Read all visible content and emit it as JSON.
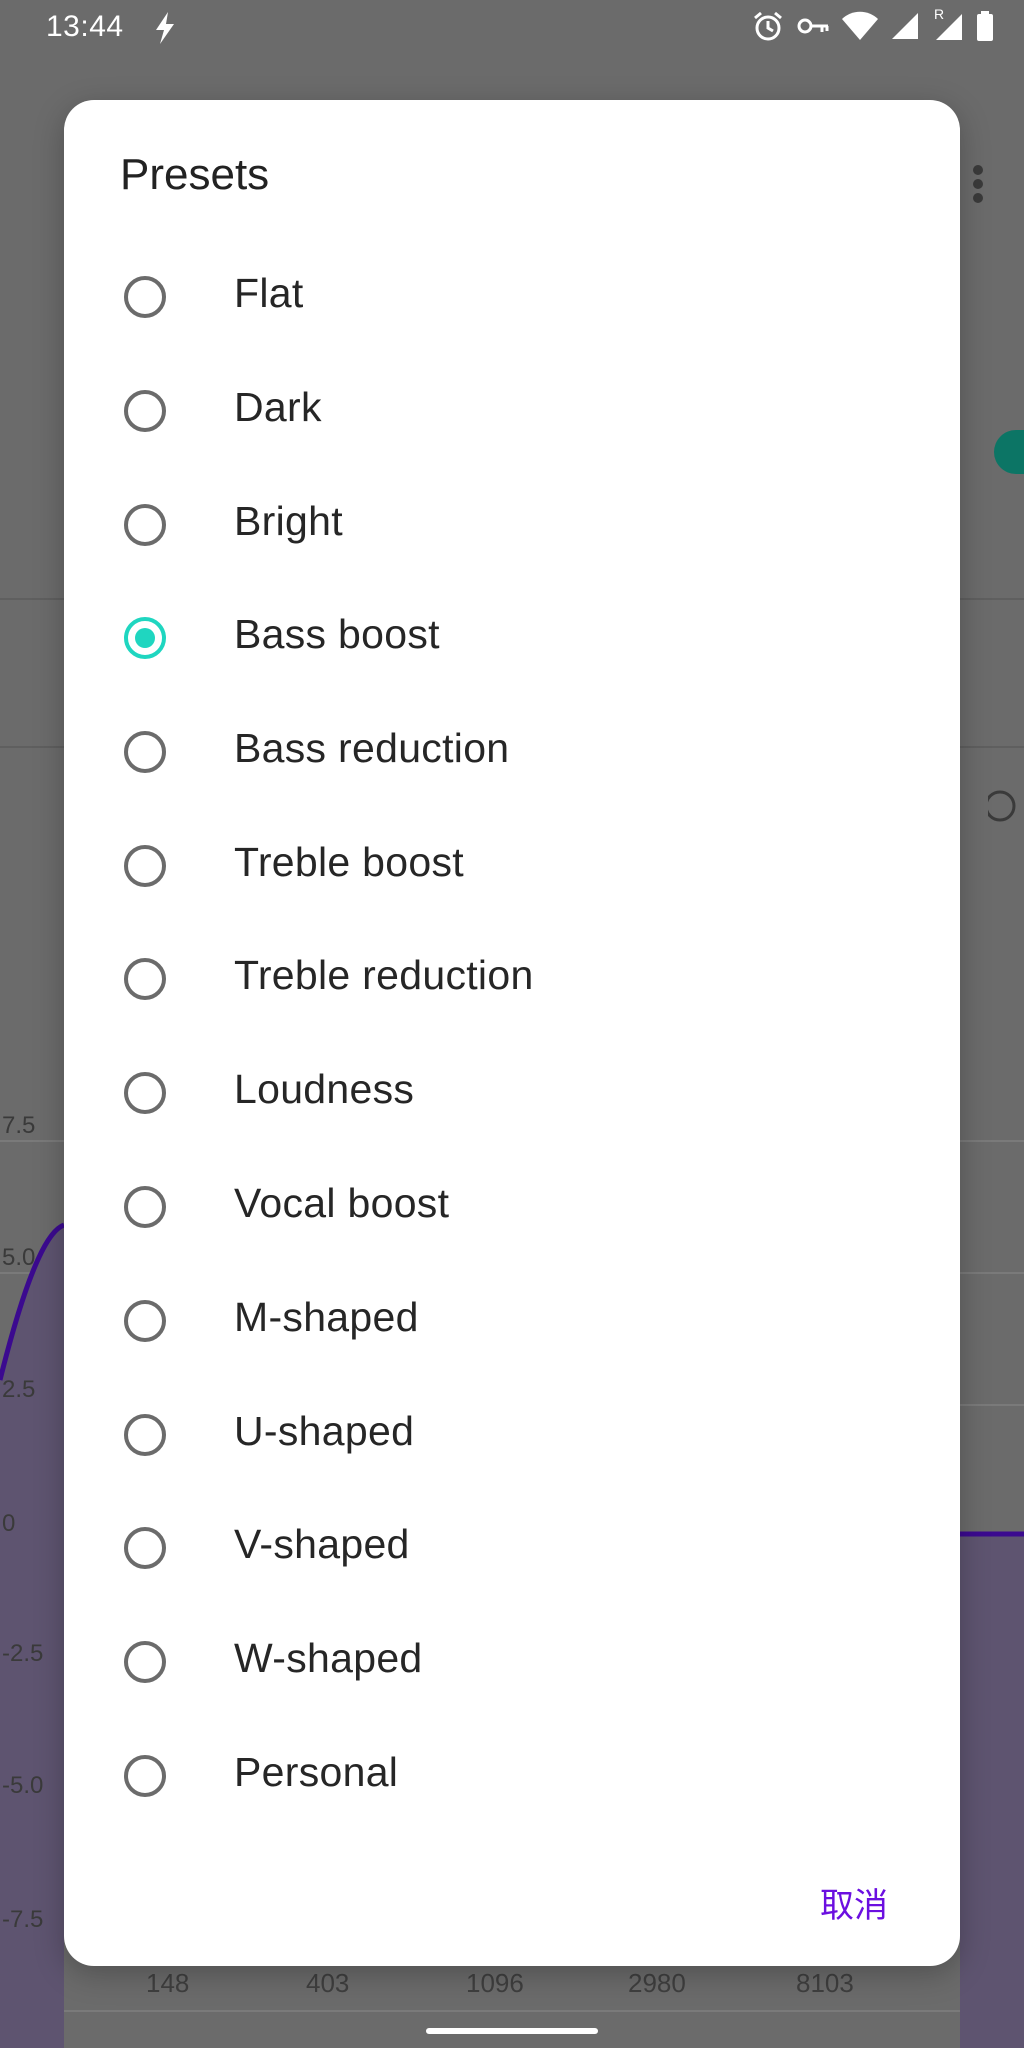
{
  "status_bar": {
    "time": "13:44",
    "icons": [
      "flash-icon",
      "alarm-icon",
      "vpn-key-icon",
      "wifi-icon",
      "signal-icon",
      "signal-roaming-icon",
      "battery-icon"
    ],
    "roaming_label": "R"
  },
  "background": {
    "chart_y_labels": [
      "7.5",
      "5.0",
      "2.5",
      "0",
      "-2.5",
      "-5.0",
      "-7.5"
    ],
    "chart_x_labels": [
      "148",
      "403",
      "1096",
      "2980",
      "8103"
    ],
    "accent_color": "#3b0a8f"
  },
  "dialog": {
    "title": "Presets",
    "options": [
      {
        "label": "Flat",
        "selected": false
      },
      {
        "label": "Dark",
        "selected": false
      },
      {
        "label": "Bright",
        "selected": false
      },
      {
        "label": "Bass boost",
        "selected": true
      },
      {
        "label": "Bass reduction",
        "selected": false
      },
      {
        "label": "Treble boost",
        "selected": false
      },
      {
        "label": "Treble reduction",
        "selected": false
      },
      {
        "label": "Loudness",
        "selected": false
      },
      {
        "label": "Vocal boost",
        "selected": false
      },
      {
        "label": "M-shaped",
        "selected": false
      },
      {
        "label": "U-shaped",
        "selected": false
      },
      {
        "label": "V-shaped",
        "selected": false
      },
      {
        "label": "W-shaped",
        "selected": false
      },
      {
        "label": "Personal",
        "selected": false
      }
    ],
    "cancel_label": "取消",
    "radio_color": "#1fd6c0",
    "cancel_color": "#6b0fe0"
  }
}
